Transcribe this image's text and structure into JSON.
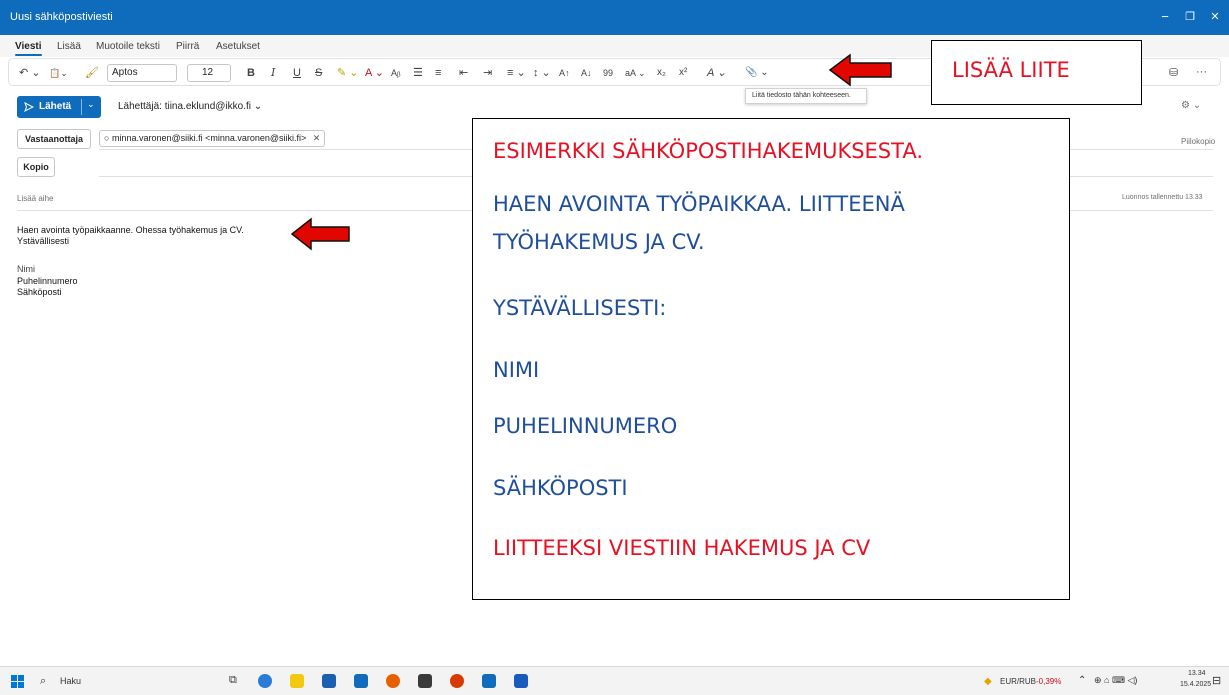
{
  "window": {
    "title": "Uusi sähköpostiviesti",
    "minimize": "−",
    "restore": "❐",
    "close": "✕"
  },
  "tabs": [
    "Viesti",
    "Lisää",
    "Muotoile teksti",
    "Piirrä",
    "Asetukset"
  ],
  "toolbar": {
    "undo": "↶ ⌄",
    "paste": "📋⌄",
    "format_painter": "🖌",
    "font": "Aptos",
    "size": "12",
    "bold": "B",
    "italic": "I",
    "underline": "U",
    "strike": "S",
    "highlight": "✎ ⌄",
    "font_color": "A ⌄",
    "clear_format": "Aᵦ",
    "bullets": "☰",
    "numbering": "≡",
    "outdent": "⇤",
    "indent": "⇥",
    "align": "≡ ⌄",
    "spacing": "↕ ⌄",
    "ltr": "A↑",
    "rtl": "A↓",
    "quote": "99",
    "change_case": "aA ⌄",
    "subscript": "x₂",
    "superscript": "x²",
    "styles": "A ⌄",
    "attach": "📎 ⌄",
    "attach_tooltip": "Liitä tiedosto tähän kohteeseen.",
    "right_icon": "⛁",
    "more": "···"
  },
  "send": {
    "label": "Lähetä",
    "chevron": "⌄"
  },
  "from": "Lähettäjä: tiina.eklund@ikko.fi ⌄",
  "to_button": "Vastaanottaja",
  "to_recipient": "minna.varonen@siiki.fi <minna.varonen@siiki.fi>",
  "remove": "✕",
  "cc_button": "Kopio",
  "bcc": "Piilokopio",
  "subject_placeholder": "Lisää aihe",
  "draft_saved": "Luonnos tallennettu 13.33",
  "body": {
    "line1": "Haen avointa työpaikkaanne. Ohessa työhakemus ja CV.",
    "line2": "Ystävällisesti",
    "line3": "Nimi",
    "line4": "Puhelinnumero",
    "line5": "Sähköposti"
  },
  "annotations": {
    "attach_label": "LISÄÄ LIITE",
    "example_title": "ESIMERKKI SÄHKÖPOSTIHAKEMUKSESTA.",
    "example_line1a": "HAEN AVOINTA TYÖPAIKKAA. LIITTEENÄ",
    "example_line1b": "TYÖHAKEMUS JA CV.",
    "example_regards": "YSTÄVÄLLISESTI:",
    "example_name": "NIMI",
    "example_phone": "PUHELINNUMERO",
    "example_email": "SÄHKÖPOSTI",
    "example_attach": "LIITTEEKSI VIESTIIN HAKEMUS JA CV"
  },
  "taskbar": {
    "search": "Haku",
    "currency": "EUR/RUB",
    "change": "-0,39%",
    "time": "13.34",
    "date": "15.4.2025"
  },
  "colors": {
    "accent": "#0f6cbd",
    "annotation_red": "#e81123",
    "annotation_blue": "#1f4e9c",
    "arrow_red": "#e10600"
  }
}
